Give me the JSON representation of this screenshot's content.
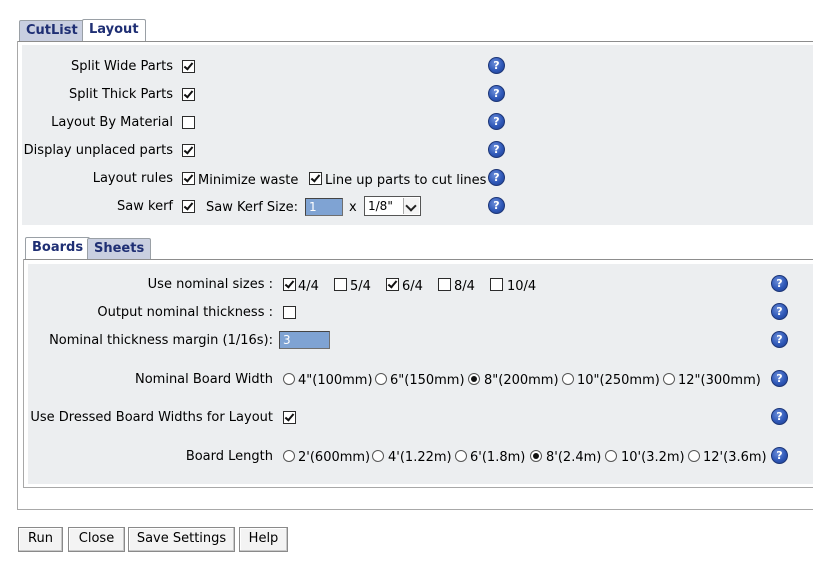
{
  "top_tabs": [
    {
      "label": "CutList",
      "active": false
    },
    {
      "label": "Layout",
      "active": true
    }
  ],
  "layout": {
    "split_wide_parts": {
      "label": "Split Wide Parts",
      "checked": true
    },
    "split_thick_parts": {
      "label": "Split Thick Parts",
      "checked": true
    },
    "layout_by_material": {
      "label": "Layout By Material",
      "checked": false
    },
    "display_unplaced_parts": {
      "label": "Display unplaced parts",
      "checked": true
    },
    "layout_rules": {
      "label": "Layout rules",
      "minimize_waste": {
        "label": "Minimize waste",
        "checked": true
      },
      "line_up_parts": {
        "label": "Line up parts to cut lines",
        "checked": true
      }
    },
    "saw_kerf": {
      "label": "Saw kerf",
      "checked": true,
      "size_label": "Saw Kerf Size:",
      "size_value": "1",
      "times": "x",
      "unit_selected": "1/8\""
    }
  },
  "sub_tabs": [
    {
      "label": "Boards",
      "active": true
    },
    {
      "label": "Sheets",
      "active": false
    }
  ],
  "boards": {
    "nominal_sizes": {
      "label": "Use nominal sizes :",
      "options": [
        {
          "label": "4/4",
          "checked": true
        },
        {
          "label": "5/4",
          "checked": false
        },
        {
          "label": "6/4",
          "checked": true
        },
        {
          "label": "8/4",
          "checked": false
        },
        {
          "label": "10/4",
          "checked": false
        }
      ]
    },
    "output_nominal_thickness": {
      "label": "Output nominal thickness :",
      "checked": false
    },
    "nominal_thickness_margin": {
      "label": "Nominal thickness margin (1/16s):",
      "value": "3"
    },
    "nominal_board_width": {
      "label": "Nominal Board Width",
      "options": [
        {
          "label": "4\"(100mm)",
          "selected": false
        },
        {
          "label": "6\"(150mm)",
          "selected": false
        },
        {
          "label": "8\"(200mm)",
          "selected": true
        },
        {
          "label": "10\"(250mm)",
          "selected": false
        },
        {
          "label": "12\"(300mm)",
          "selected": false
        }
      ]
    },
    "use_dressed_widths": {
      "label": "Use Dressed Board Widths for Layout",
      "checked": true
    },
    "board_length": {
      "label": "Board Length",
      "options": [
        {
          "label": "2'(600mm)",
          "selected": false
        },
        {
          "label": "4'(1.22m)",
          "selected": false
        },
        {
          "label": "6'(1.8m)",
          "selected": false
        },
        {
          "label": "8'(2.4m)",
          "selected": true
        },
        {
          "label": "10'(3.2m)",
          "selected": false
        },
        {
          "label": "12'(3.6m)",
          "selected": false
        }
      ]
    }
  },
  "help_icon_glyph": "?",
  "buttons": {
    "run": "Run",
    "close": "Close",
    "save_settings": "Save Settings",
    "help": "Help"
  }
}
